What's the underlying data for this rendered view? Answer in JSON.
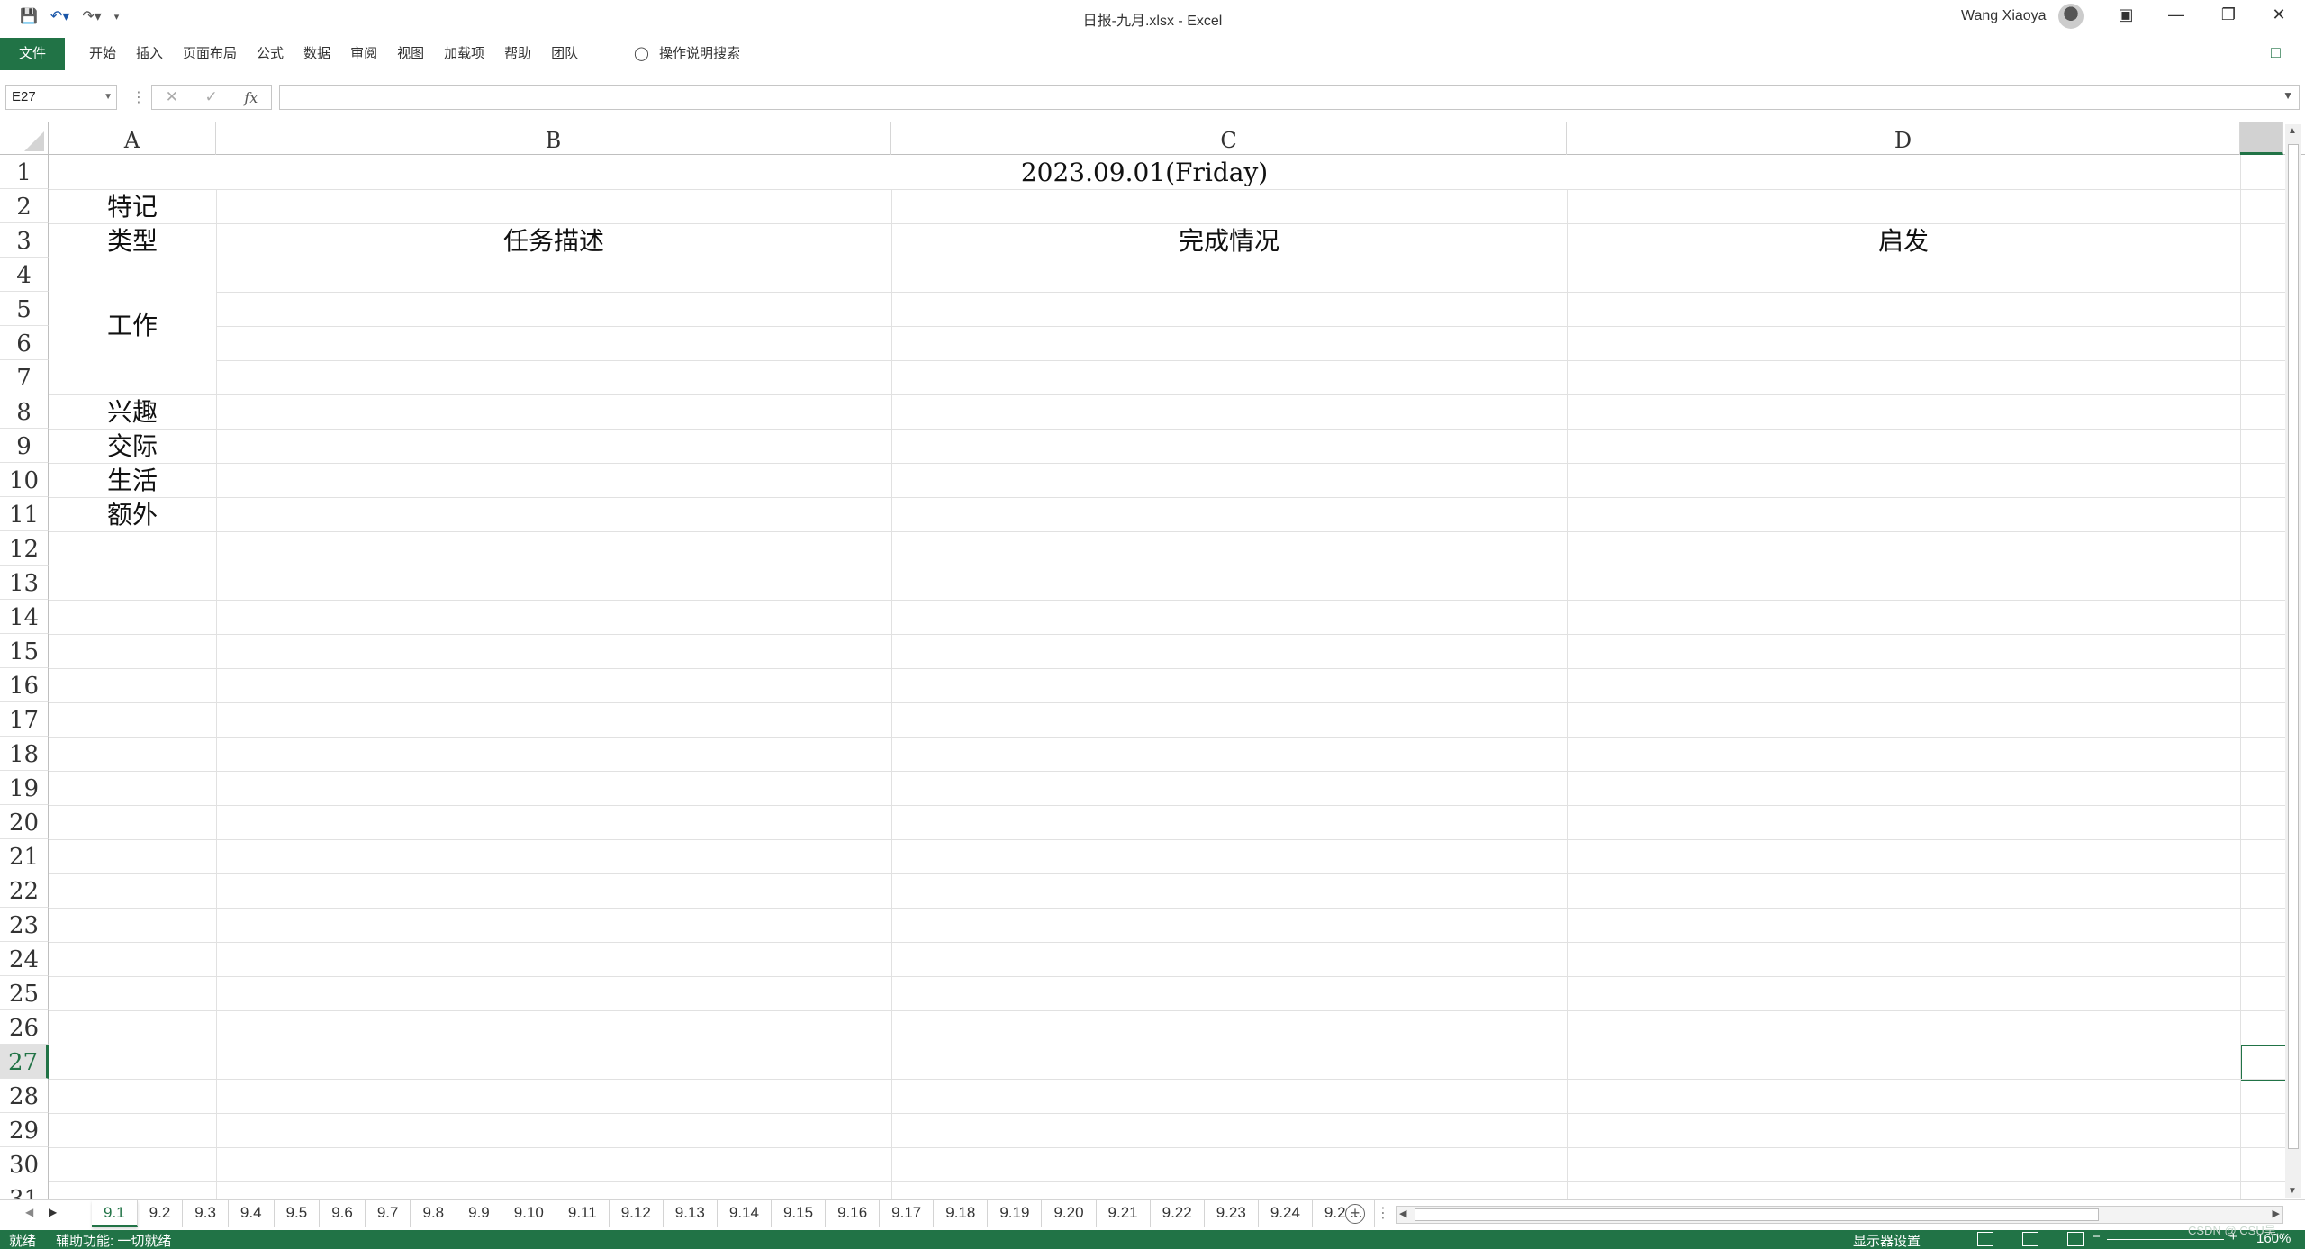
{
  "titlebar": {
    "document_title": "日报-九月.xlsx  -  Excel",
    "user_name": "Wang Xiaoya",
    "icons": [
      "save-icon",
      "undo-icon",
      "redo-icon",
      "customize-icon",
      "ribbon-display-icon",
      "minimize-icon",
      "restore-icon",
      "close-icon"
    ]
  },
  "ribbon": {
    "file_tab": "文件",
    "tabs": [
      "开始",
      "插入",
      "页面布局",
      "公式",
      "数据",
      "审阅",
      "视图",
      "加载项",
      "帮助",
      "团队"
    ],
    "search_label": "操作说明搜索"
  },
  "formula_bar": {
    "name_box": "E27",
    "fx_label": "fx",
    "formula": ""
  },
  "grid": {
    "columns": [
      "A",
      "B",
      "C",
      "D"
    ],
    "rows": [
      "1",
      "2",
      "3",
      "4",
      "5",
      "6",
      "7",
      "8",
      "9",
      "10",
      "11",
      "12",
      "13",
      "14",
      "15",
      "16",
      "17",
      "18",
      "19",
      "20",
      "21",
      "22",
      "23",
      "24",
      "25",
      "26",
      "27",
      "28",
      "29",
      "30",
      "31"
    ],
    "selected_cell": "E27",
    "cells": {
      "title": "2023.09.01(Friday)",
      "a2": "特记",
      "a3": "类型",
      "b3": "任务描述",
      "c3": "完成情况",
      "d3": "启发",
      "a4_7": "工作",
      "a8": "兴趣",
      "a9": "交际",
      "a10": "生活",
      "a11": "额外"
    }
  },
  "sheet_tabs": {
    "tabs": [
      "9.1",
      "9.2",
      "9.3",
      "9.4",
      "9.5",
      "9.6",
      "9.7",
      "9.8",
      "9.9",
      "9.10",
      "9.11",
      "9.12",
      "9.13",
      "9.14",
      "9.15",
      "9.16",
      "9.17",
      "9.18",
      "9.19",
      "9.20",
      "9.21",
      "9.22",
      "9.23",
      "9.24",
      "9.2 ..."
    ],
    "active": "9.1"
  },
  "status_bar": {
    "ready": "就绪",
    "accessibility": "辅助功能: 一切就绪",
    "display_settings": "显示器设置",
    "zoom": "160%",
    "watermark": "CSDN @ CSU吴..."
  },
  "colors": {
    "accent": "#217346",
    "grid_line": "#e1e1e1"
  }
}
